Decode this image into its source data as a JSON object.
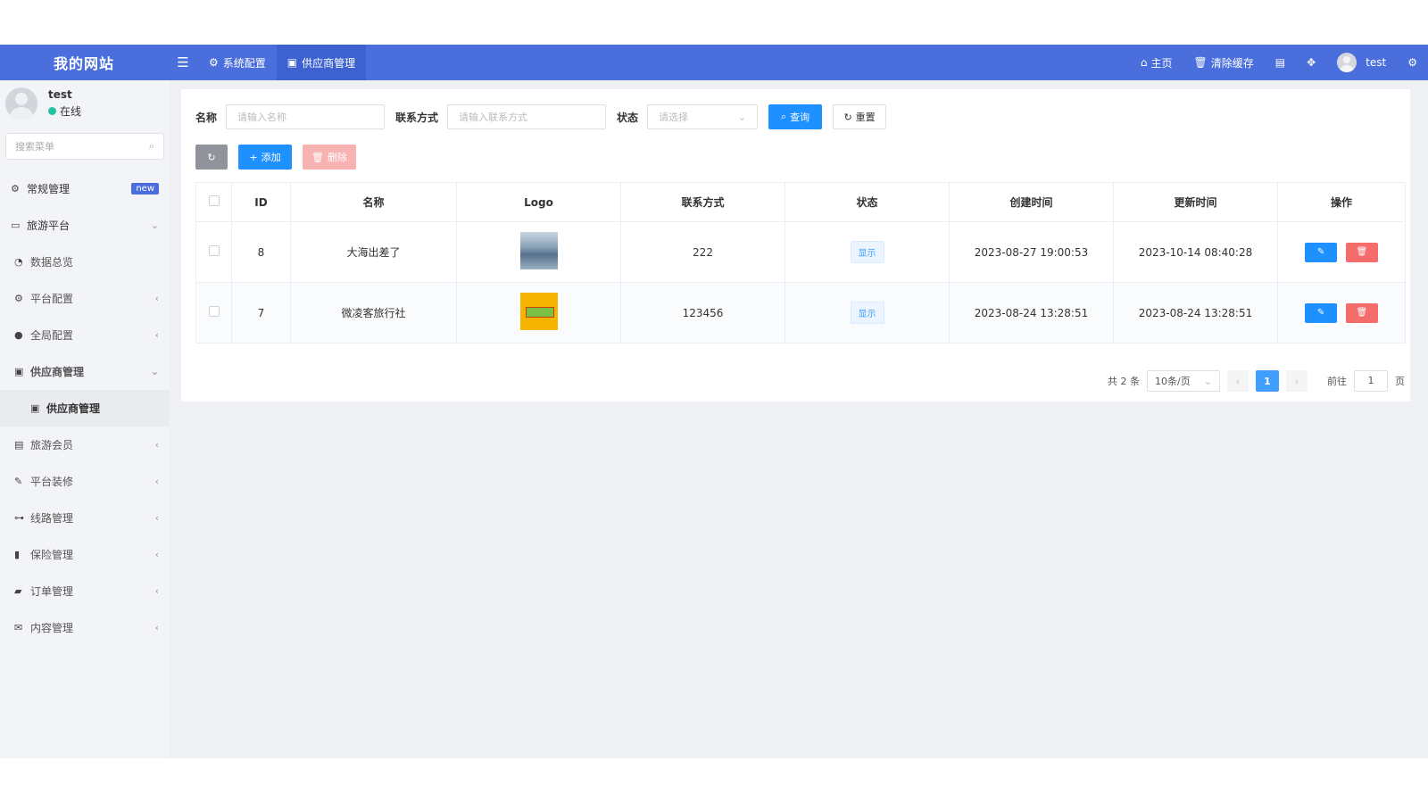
{
  "header": {
    "brand": "我的网站",
    "tabs": [
      {
        "label": "系统配置",
        "icon": "gear-icon"
      },
      {
        "label": "供应商管理",
        "icon": "building-icon"
      }
    ],
    "right": {
      "home": "主页",
      "clear_cache": "清除缓存",
      "user": "test"
    }
  },
  "sidebar": {
    "user_name": "test",
    "user_status": "在线",
    "search_placeholder": "搜索菜单",
    "items": [
      {
        "label": "常规管理",
        "badge": "new",
        "icon": "cogs-icon"
      },
      {
        "label": "旅游平台",
        "icon": "bus-icon"
      },
      {
        "label": "数据总览",
        "icon": "dashboard-icon"
      },
      {
        "label": "平台配置",
        "icon": "cogs-icon"
      },
      {
        "label": "全局配置",
        "icon": "info-icon"
      },
      {
        "label": "供应商管理",
        "icon": "building-icon"
      },
      {
        "label": "供应商管理",
        "icon": "building-icon"
      },
      {
        "label": "旅游会员",
        "icon": "idcard-icon"
      },
      {
        "label": "平台装修",
        "icon": "brush-icon"
      },
      {
        "label": "线路管理",
        "icon": "usb-icon"
      },
      {
        "label": "保险管理",
        "icon": "file-icon"
      },
      {
        "label": "订单管理",
        "icon": "folder-icon"
      },
      {
        "label": "内容管理",
        "icon": "mail-icon"
      }
    ]
  },
  "filters": {
    "name_label": "名称",
    "name_placeholder": "请输入名称",
    "contact_label": "联系方式",
    "contact_placeholder": "请输入联系方式",
    "status_label": "状态",
    "status_placeholder": "请选择",
    "query_btn": "查询",
    "reset_btn": "重置"
  },
  "toolbar": {
    "add_btn": "添加",
    "delete_btn": "删除"
  },
  "table": {
    "columns": [
      "ID",
      "名称",
      "Logo",
      "联系方式",
      "状态",
      "创建时间",
      "更新时间",
      "操作"
    ],
    "rows": [
      {
        "id": "8",
        "name": "大海出差了",
        "contact": "222",
        "status": "显示",
        "created": "2023-08-27 19:00:53",
        "updated": "2023-10-14 08:40:28"
      },
      {
        "id": "7",
        "name": "微凌客旅行社",
        "contact": "123456",
        "status": "显示",
        "created": "2023-08-24 13:28:51",
        "updated": "2023-08-24 13:28:51"
      }
    ]
  },
  "pager": {
    "total": "共 2 条",
    "page_size": "10条/页",
    "current_page": "1",
    "goto_label": "前往",
    "goto_value": "1",
    "page_suffix": "页"
  },
  "colors": {
    "header_bg": "#4a6fdc",
    "primary": "#1e90ff",
    "danger": "#f56c6c"
  }
}
